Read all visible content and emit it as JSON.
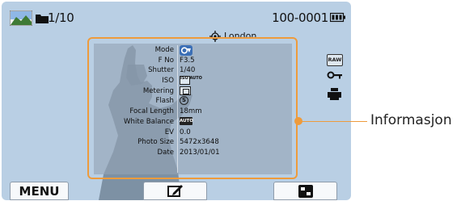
{
  "status": {
    "counter": "1/10",
    "file_number": "100-0001",
    "location": "London"
  },
  "icons": {
    "raw_label": "RAW",
    "iso_label": "ISO AUTO",
    "wb_label": "AUTO",
    "flash_label": "S"
  },
  "info": {
    "rows": [
      {
        "label": "Mode",
        "value": ""
      },
      {
        "label": "F No",
        "value": "F3.5"
      },
      {
        "label": "Shutter",
        "value": "1/40"
      },
      {
        "label": "ISO",
        "value": ""
      },
      {
        "label": "Metering",
        "value": ""
      },
      {
        "label": "Flash",
        "value": ""
      },
      {
        "label": "Focal Length",
        "value": "18mm"
      },
      {
        "label": "White Balance",
        "value": ""
      },
      {
        "label": "EV",
        "value": "0.0"
      },
      {
        "label": "Photo Size",
        "value": "5472x3648"
      },
      {
        "label": "Date",
        "value": "2013/01/01"
      }
    ]
  },
  "bottom": {
    "menu_label": "MENU"
  },
  "callout": {
    "label": "Informasjon"
  },
  "colors": {
    "screen": "#b9cfe4",
    "accent": "#ee9b3c"
  }
}
